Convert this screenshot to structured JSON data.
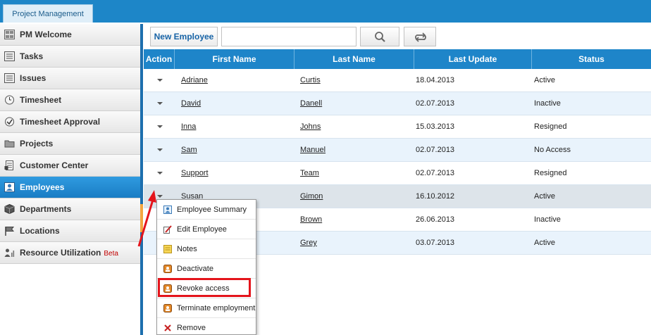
{
  "app": {
    "tab_label": "Project Management"
  },
  "sidebar": {
    "items": [
      {
        "label": "PM Welcome",
        "icon": "dashboard-icon"
      },
      {
        "label": "Tasks",
        "icon": "list-icon"
      },
      {
        "label": "Issues",
        "icon": "list-icon"
      },
      {
        "label": "Timesheet",
        "icon": "clock-icon"
      },
      {
        "label": "Timesheet Approval",
        "icon": "check-clock-icon"
      },
      {
        "label": "Projects",
        "icon": "folder-icon"
      },
      {
        "label": "Customer Center",
        "icon": "document-icon"
      },
      {
        "label": "Employees",
        "icon": "employee-card-icon",
        "active": true
      },
      {
        "label": "Departments",
        "icon": "cube-icon"
      },
      {
        "label": "Locations",
        "icon": "flag-icon"
      },
      {
        "label": "Resource Utilization",
        "icon": "people-chart-icon",
        "badge": "Beta"
      }
    ]
  },
  "toolbar": {
    "new_employee_label": "New Employee",
    "search_value": "",
    "search_icon": "search-icon",
    "reset_icon": "refresh-icon"
  },
  "grid": {
    "columns": [
      "Action",
      "First Name",
      "Last Name",
      "Last Update",
      "Status"
    ],
    "rows": [
      {
        "first": "Adriane",
        "last": "Curtis",
        "updated": "18.04.2013",
        "status": "Active"
      },
      {
        "first": "David",
        "last": "Danell",
        "updated": "02.07.2013",
        "status": "Inactive"
      },
      {
        "first": "Inna",
        "last": "Johns",
        "updated": "15.03.2013",
        "status": "Resigned"
      },
      {
        "first": "Sam",
        "last": "Manuel",
        "updated": "02.07.2013",
        "status": "No Access"
      },
      {
        "first": "Support",
        "last": "Team",
        "updated": "02.07.2013",
        "status": "Resigned"
      },
      {
        "first": "Susan",
        "last": "Gimon",
        "updated": "16.10.2012",
        "status": "Active"
      },
      {
        "first": "",
        "last": "Brown",
        "updated": "26.06.2013",
        "status": "Inactive"
      },
      {
        "first": "",
        "last": "Grey",
        "updated": "03.07.2013",
        "status": "Active"
      }
    ]
  },
  "context_menu": {
    "items": [
      {
        "label": "Employee Summary",
        "icon": "summary-icon"
      },
      {
        "label": "Edit Employee",
        "icon": "edit-icon"
      },
      {
        "label": "Notes",
        "icon": "notes-icon"
      },
      {
        "label": "Deactivate",
        "icon": "deactivate-icon"
      },
      {
        "label": "Revoke access",
        "icon": "revoke-icon",
        "highlighted": true
      },
      {
        "label": "Terminate employment",
        "icon": "terminate-icon"
      },
      {
        "label": "Remove",
        "icon": "remove-icon"
      }
    ]
  },
  "colors": {
    "header_blue": "#1e85c9",
    "active_nav": "#1a7dc4",
    "highlight_red": "#e4141b",
    "beta_red": "#c00000"
  }
}
